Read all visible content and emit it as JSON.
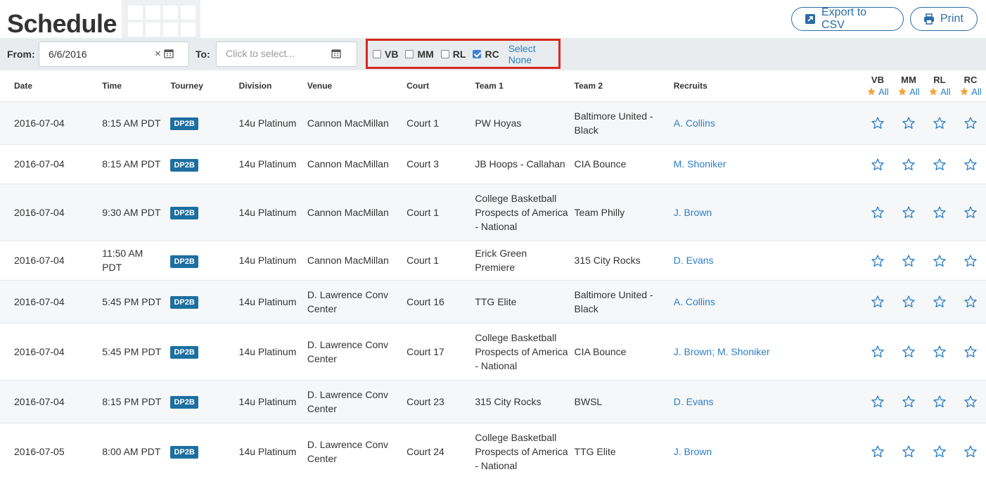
{
  "header": {
    "title": "Schedule",
    "export_label": "Export to CSV",
    "print_label": "Print"
  },
  "filters": {
    "from_label": "From:",
    "from_value": "6/6/2016",
    "clear_symbol": "×",
    "to_label": "To:",
    "to_placeholder": "Click to select...",
    "checkboxes": [
      {
        "label": "VB",
        "checked": false
      },
      {
        "label": "MM",
        "checked": false
      },
      {
        "label": "RL",
        "checked": false
      },
      {
        "label": "RC",
        "checked": true
      }
    ],
    "select_none_label": "Select None"
  },
  "table": {
    "columns": [
      "Date",
      "Time",
      "Tourney",
      "Division",
      "Venue",
      "Court",
      "Team 1",
      "Team 2",
      "Recruits"
    ],
    "rank_columns": [
      "VB",
      "MM",
      "RL",
      "RC"
    ],
    "rank_all_label": "All",
    "rows": [
      {
        "date": "2016-07-04",
        "time": "8:15 AM PDT",
        "tourney": "DP2B",
        "division": "14u Platinum",
        "venue": "Cannon MacMillan",
        "court": "Court 1",
        "team1": "PW Hoyas",
        "team2": "Baltimore United - Black",
        "recruits": "A. Collins"
      },
      {
        "date": "2016-07-04",
        "time": "8:15 AM PDT",
        "tourney": "DP2B",
        "division": "14u Platinum",
        "venue": "Cannon MacMillan",
        "court": "Court 3",
        "team1": "JB Hoops - Callahan",
        "team2": "CIA Bounce",
        "recruits": "M. Shoniker"
      },
      {
        "date": "2016-07-04",
        "time": "9:30 AM PDT",
        "tourney": "DP2B",
        "division": "14u Platinum",
        "venue": "Cannon MacMillan",
        "court": "Court 1",
        "team1": "College Basketball Prospects of America - National",
        "team2": "Team Philly",
        "recruits": "J. Brown"
      },
      {
        "date": "2016-07-04",
        "time": "11:50 AM PDT",
        "tourney": "DP2B",
        "division": "14u Platinum",
        "venue": "Cannon MacMillan",
        "court": "Court 1",
        "team1": "Erick Green Premiere",
        "team2": "315 City Rocks",
        "recruits": "D. Evans"
      },
      {
        "date": "2016-07-04",
        "time": "5:45 PM PDT",
        "tourney": "DP2B",
        "division": "14u Platinum",
        "venue": "D. Lawrence Conv Center",
        "court": "Court 16",
        "team1": "TTG Elite",
        "team2": "Baltimore United - Black",
        "recruits": "A. Collins"
      },
      {
        "date": "2016-07-04",
        "time": "5:45 PM PDT",
        "tourney": "DP2B",
        "division": "14u Platinum",
        "venue": "D. Lawrence Conv Center",
        "court": "Court 17",
        "team1": "College Basketball Prospects of America - National",
        "team2": "CIA Bounce",
        "recruits": "J. Brown; M. Shoniker"
      },
      {
        "date": "2016-07-04",
        "time": "8:15 PM PDT",
        "tourney": "DP2B",
        "division": "14u Platinum",
        "venue": "D. Lawrence Conv Center",
        "court": "Court 23",
        "team1": "315 City Rocks",
        "team2": "BWSL",
        "recruits": "D. Evans"
      },
      {
        "date": "2016-07-05",
        "time": "8:00 AM PDT",
        "tourney": "DP2B",
        "division": "14u Platinum",
        "venue": "D. Lawrence Conv Center",
        "court": "Court 24",
        "team1": "College Basketball Prospects of America - National",
        "team2": "TTG Elite",
        "recruits": "J. Brown"
      }
    ]
  },
  "colors": {
    "accent": "#2a7fc7",
    "badge": "#1d6fa0",
    "highlight_border": "#d8281e",
    "star_filled": "#f0a33a",
    "filter_bg": "#e8ecee"
  },
  "icons": {
    "export": "external-link-icon",
    "print": "printer-icon",
    "calendar": "calendar-icon",
    "rank_star": "star-outline-icon",
    "all_star": "star-filled-icon"
  }
}
